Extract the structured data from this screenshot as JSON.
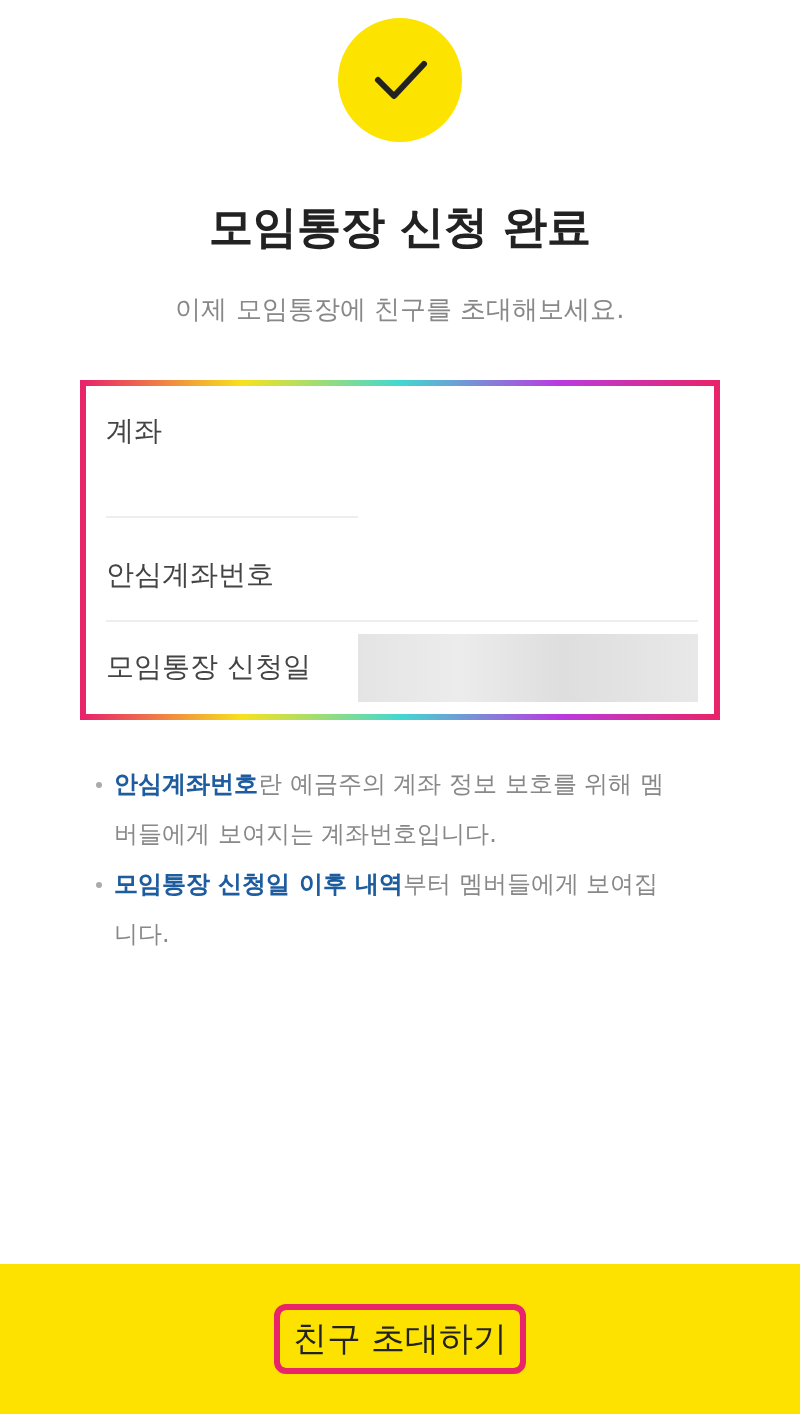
{
  "title": "모임통장 신청 완료",
  "subtitle": "이제 모임통장에 친구를 초대해보세요.",
  "card": {
    "highlighted": true,
    "rows": [
      {
        "label": "계좌",
        "masked": false
      },
      {
        "label": "안심계좌번호",
        "masked": false
      },
      {
        "label": "모임통장 신청일",
        "masked": true
      }
    ]
  },
  "notes": [
    "**안심계좌번호**란 예금주의 계좌 정보 보호를 위해 멤버들에게 보여지는 계좌번호입니다.",
    "**모임통장 신청일 이후 내역**부터 멤버들에게 보여집니다."
  ],
  "button": {
    "label": "친구 초대하기",
    "highlighted": true
  }
}
